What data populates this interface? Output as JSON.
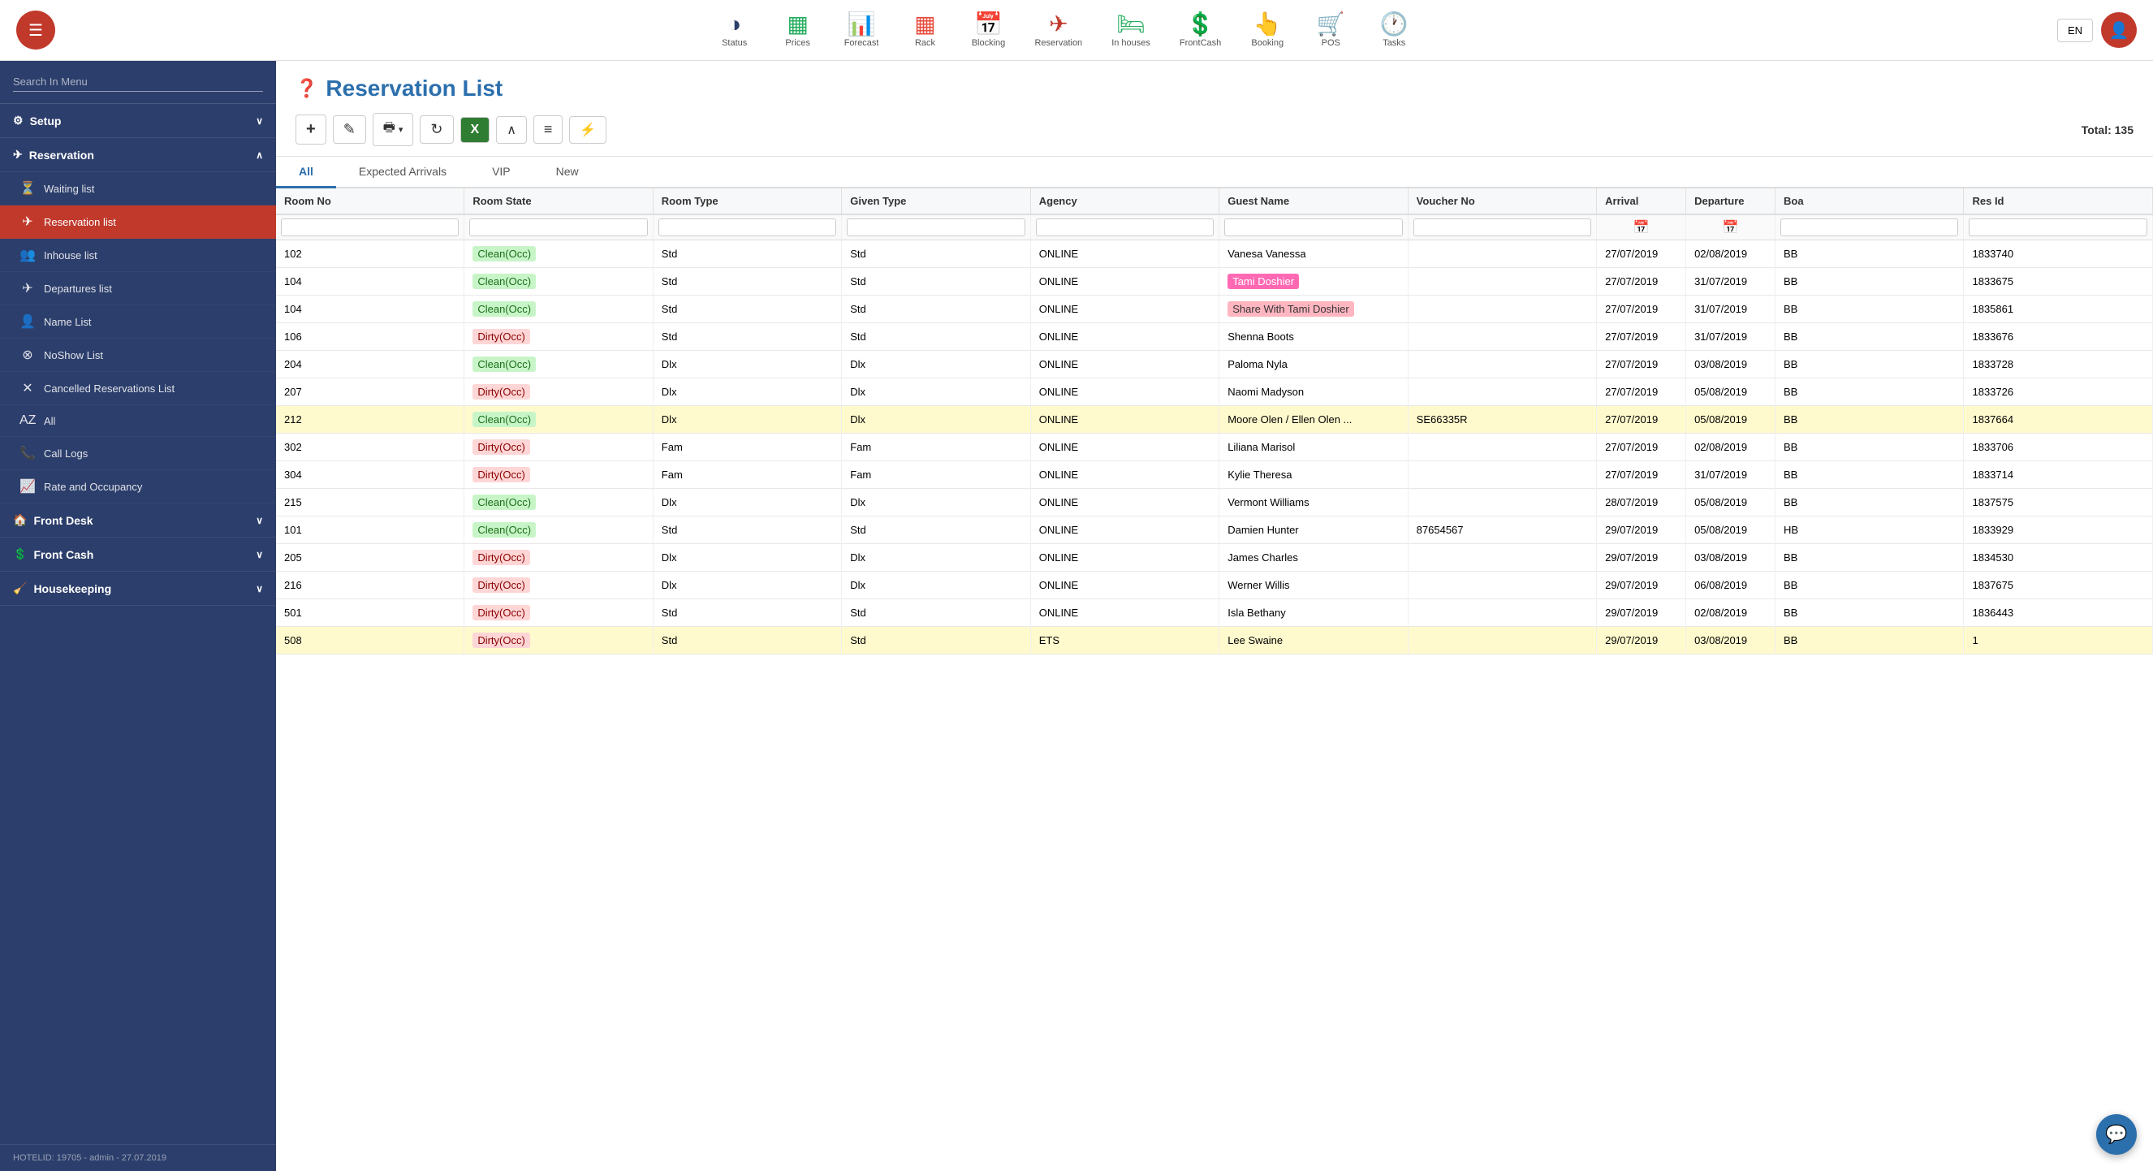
{
  "topNav": {
    "items": [
      {
        "id": "status",
        "icon": "◑",
        "label": "Status",
        "color": "#2c3e6b"
      },
      {
        "id": "prices",
        "icon": "▦",
        "label": "Prices",
        "color": "#27ae60"
      },
      {
        "id": "forecast",
        "icon": "📊",
        "label": "Forecast",
        "color": "#27ae60"
      },
      {
        "id": "rack",
        "icon": "▦",
        "label": "Rack",
        "color": "#e74c3c"
      },
      {
        "id": "blocking",
        "icon": "📅",
        "label": "Blocking",
        "color": "#8e44ad"
      },
      {
        "id": "reservation",
        "icon": "✈",
        "label": "Reservation",
        "color": "#c0392b"
      },
      {
        "id": "inhouses",
        "icon": "🛏",
        "label": "In houses",
        "color": "#27ae60"
      },
      {
        "id": "frontcash",
        "icon": "💲",
        "label": "FrontCash",
        "color": "#27ae60"
      },
      {
        "id": "booking",
        "icon": "👆",
        "label": "Booking",
        "color": "#e67e22"
      },
      {
        "id": "pos",
        "icon": "🛒",
        "label": "POS",
        "color": "#e74c3c"
      },
      {
        "id": "tasks",
        "icon": "🕐",
        "label": "Tasks",
        "color": "#e67e22"
      }
    ],
    "langLabel": "EN"
  },
  "sidebar": {
    "searchPlaceholder": "Search In Menu",
    "groups": [
      {
        "id": "setup",
        "label": "Setup",
        "icon": "⚙",
        "expanded": false,
        "items": []
      },
      {
        "id": "reservation",
        "label": "Reservation",
        "icon": "✈",
        "expanded": true,
        "items": [
          {
            "id": "waiting-list",
            "icon": "⏳",
            "label": "Waiting list",
            "active": false
          },
          {
            "id": "reservation-list",
            "icon": "✈",
            "label": "Reservation list",
            "active": true
          },
          {
            "id": "inhouse-list",
            "icon": "👥",
            "label": "Inhouse list",
            "active": false
          },
          {
            "id": "departures-list",
            "icon": "✈",
            "label": "Departures list",
            "active": false
          },
          {
            "id": "name-list",
            "icon": "👤",
            "label": "Name List",
            "active": false
          },
          {
            "id": "noshow-list",
            "icon": "⊗",
            "label": "NoShow List",
            "active": false
          },
          {
            "id": "cancelled-list",
            "icon": "✕",
            "label": "Cancelled Reservations List",
            "active": false
          },
          {
            "id": "all",
            "icon": "AZ",
            "label": "All",
            "active": false
          },
          {
            "id": "call-logs",
            "icon": "📞",
            "label": "Call Logs",
            "active": false
          },
          {
            "id": "rate-occupancy",
            "icon": "📈",
            "label": "Rate and Occupancy",
            "active": false
          }
        ]
      },
      {
        "id": "front-desk",
        "label": "Front Desk",
        "icon": "🏠",
        "expanded": false,
        "items": []
      },
      {
        "id": "front-cash",
        "label": "Front Cash",
        "icon": "💲",
        "expanded": false,
        "items": []
      },
      {
        "id": "housekeeping",
        "label": "Housekeeping",
        "icon": "🧹",
        "expanded": false,
        "items": []
      }
    ],
    "footer": "HOTELID: 19705 - admin - 27.07.2019"
  },
  "content": {
    "pageTitle": "Reservation List",
    "toolbar": {
      "addLabel": "+",
      "editLabel": "✎",
      "printLabel": "🖶",
      "refreshLabel": "↻",
      "excelLabel": "X",
      "collapseLabel": "∧",
      "menuLabel": "≡",
      "flashLabel": "⚡",
      "totalLabel": "Total: 135"
    },
    "tabs": [
      {
        "id": "all",
        "label": "All",
        "active": true
      },
      {
        "id": "expected-arrivals",
        "label": "Expected Arrivals",
        "active": false
      },
      {
        "id": "vip",
        "label": "VIP",
        "active": false
      },
      {
        "id": "new",
        "label": "New",
        "active": false
      }
    ],
    "tableHeaders": [
      "Room No",
      "Room State",
      "Room Type",
      "Given Type",
      "Agency",
      "Guest Name",
      "Voucher No",
      "Arrival",
      "Departure",
      "Boa",
      "Res Id"
    ],
    "rows": [
      {
        "roomNo": "102",
        "roomState": "Clean(Occ)",
        "stateType": "clean",
        "roomType": "Std",
        "givenType": "Std",
        "agency": "ONLINE",
        "guestName": "Vanesa Vanessa",
        "guestStyle": "normal",
        "voucherNo": "",
        "arrival": "27/07/2019",
        "departure": "02/08/2019",
        "boa": "BB",
        "resId": "1833740",
        "rowHighlight": false
      },
      {
        "roomNo": "104",
        "roomState": "Clean(Occ)",
        "stateType": "clean",
        "roomType": "Std",
        "givenType": "Std",
        "agency": "ONLINE",
        "guestName": "Tami Doshier",
        "guestStyle": "pink",
        "voucherNo": "",
        "arrival": "27/07/2019",
        "departure": "31/07/2019",
        "boa": "BB",
        "resId": "1833675",
        "rowHighlight": false
      },
      {
        "roomNo": "104",
        "roomState": "Clean(Occ)",
        "stateType": "clean",
        "roomType": "Std",
        "givenType": "Std",
        "agency": "ONLINE",
        "guestName": "Share With Tami Doshier",
        "guestStyle": "lightpink",
        "voucherNo": "",
        "arrival": "27/07/2019",
        "departure": "31/07/2019",
        "boa": "BB",
        "resId": "1835861",
        "rowHighlight": false
      },
      {
        "roomNo": "106",
        "roomState": "Dirty(Occ)",
        "stateType": "dirty",
        "roomType": "Std",
        "givenType": "Std",
        "agency": "ONLINE",
        "guestName": "Shenna Boots",
        "guestStyle": "normal",
        "voucherNo": "",
        "arrival": "27/07/2019",
        "departure": "31/07/2019",
        "boa": "BB",
        "resId": "1833676",
        "rowHighlight": false
      },
      {
        "roomNo": "204",
        "roomState": "Clean(Occ)",
        "stateType": "clean",
        "roomType": "Dlx",
        "givenType": "Dlx",
        "agency": "ONLINE",
        "guestName": "Paloma Nyla",
        "guestStyle": "normal",
        "voucherNo": "",
        "arrival": "27/07/2019",
        "departure": "03/08/2019",
        "boa": "BB",
        "resId": "1833728",
        "rowHighlight": false
      },
      {
        "roomNo": "207",
        "roomState": "Dirty(Occ)",
        "stateType": "dirty",
        "roomType": "Dlx",
        "givenType": "Dlx",
        "agency": "ONLINE",
        "guestName": "Naomi Madyson",
        "guestStyle": "normal",
        "voucherNo": "",
        "arrival": "27/07/2019",
        "departure": "05/08/2019",
        "boa": "BB",
        "resId": "1833726",
        "rowHighlight": false
      },
      {
        "roomNo": "212",
        "roomState": "Clean(Occ)",
        "stateType": "clean",
        "roomType": "Dlx",
        "givenType": "Dlx",
        "agency": "ONLINE",
        "guestName": "Moore Olen / Ellen Olen ...",
        "guestStyle": "normal",
        "voucherNo": "SE66335R",
        "arrival": "27/07/2019",
        "departure": "05/08/2019",
        "boa": "BB",
        "resId": "1837664",
        "rowHighlight": true
      },
      {
        "roomNo": "302",
        "roomState": "Dirty(Occ)",
        "stateType": "dirty",
        "roomType": "Fam",
        "givenType": "Fam",
        "agency": "ONLINE",
        "guestName": "Liliana Marisol",
        "guestStyle": "normal",
        "voucherNo": "",
        "arrival": "27/07/2019",
        "departure": "02/08/2019",
        "boa": "BB",
        "resId": "1833706",
        "rowHighlight": false
      },
      {
        "roomNo": "304",
        "roomState": "Dirty(Occ)",
        "stateType": "dirty",
        "roomType": "Fam",
        "givenType": "Fam",
        "agency": "ONLINE",
        "guestName": "Kylie Theresa",
        "guestStyle": "normal",
        "voucherNo": "",
        "arrival": "27/07/2019",
        "departure": "31/07/2019",
        "boa": "BB",
        "resId": "1833714",
        "rowHighlight": false
      },
      {
        "roomNo": "215",
        "roomState": "Clean(Occ)",
        "stateType": "clean",
        "roomType": "Dlx",
        "givenType": "Dlx",
        "agency": "ONLINE",
        "guestName": "Vermont Williams",
        "guestStyle": "normal",
        "voucherNo": "",
        "arrival": "28/07/2019",
        "departure": "05/08/2019",
        "boa": "BB",
        "resId": "1837575",
        "rowHighlight": false
      },
      {
        "roomNo": "101",
        "roomState": "Clean(Occ)",
        "stateType": "clean",
        "roomType": "Std",
        "givenType": "Std",
        "agency": "ONLINE",
        "guestName": "Damien Hunter",
        "guestStyle": "normal",
        "voucherNo": "87654567",
        "arrival": "29/07/2019",
        "departure": "05/08/2019",
        "boa": "HB",
        "resId": "1833929",
        "rowHighlight": false
      },
      {
        "roomNo": "205",
        "roomState": "Dirty(Occ)",
        "stateType": "dirty",
        "roomType": "Dlx",
        "givenType": "Dlx",
        "agency": "ONLINE",
        "guestName": "James Charles",
        "guestStyle": "normal",
        "voucherNo": "",
        "arrival": "29/07/2019",
        "departure": "03/08/2019",
        "boa": "BB",
        "resId": "1834530",
        "rowHighlight": false
      },
      {
        "roomNo": "216",
        "roomState": "Dirty(Occ)",
        "stateType": "dirty",
        "roomType": "Dlx",
        "givenType": "Dlx",
        "agency": "ONLINE",
        "guestName": "Werner Willis",
        "guestStyle": "normal",
        "voucherNo": "",
        "arrival": "29/07/2019",
        "departure": "06/08/2019",
        "boa": "BB",
        "resId": "1837675",
        "rowHighlight": false
      },
      {
        "roomNo": "501",
        "roomState": "Dirty(Occ)",
        "stateType": "dirty",
        "roomType": "Std",
        "givenType": "Std",
        "agency": "ONLINE",
        "guestName": "Isla Bethany",
        "guestStyle": "normal",
        "voucherNo": "",
        "arrival": "29/07/2019",
        "departure": "02/08/2019",
        "boa": "BB",
        "resId": "1836443",
        "rowHighlight": false
      },
      {
        "roomNo": "508",
        "roomState": "Dirty(Occ)",
        "stateType": "dirty",
        "roomType": "Std",
        "givenType": "Std",
        "agency": "ETS",
        "guestName": "Lee Swaine",
        "guestStyle": "normal",
        "voucherNo": "",
        "arrival": "29/07/2019",
        "departure": "03/08/2019",
        "boa": "BB",
        "resId": "1",
        "rowHighlight": true
      }
    ]
  }
}
